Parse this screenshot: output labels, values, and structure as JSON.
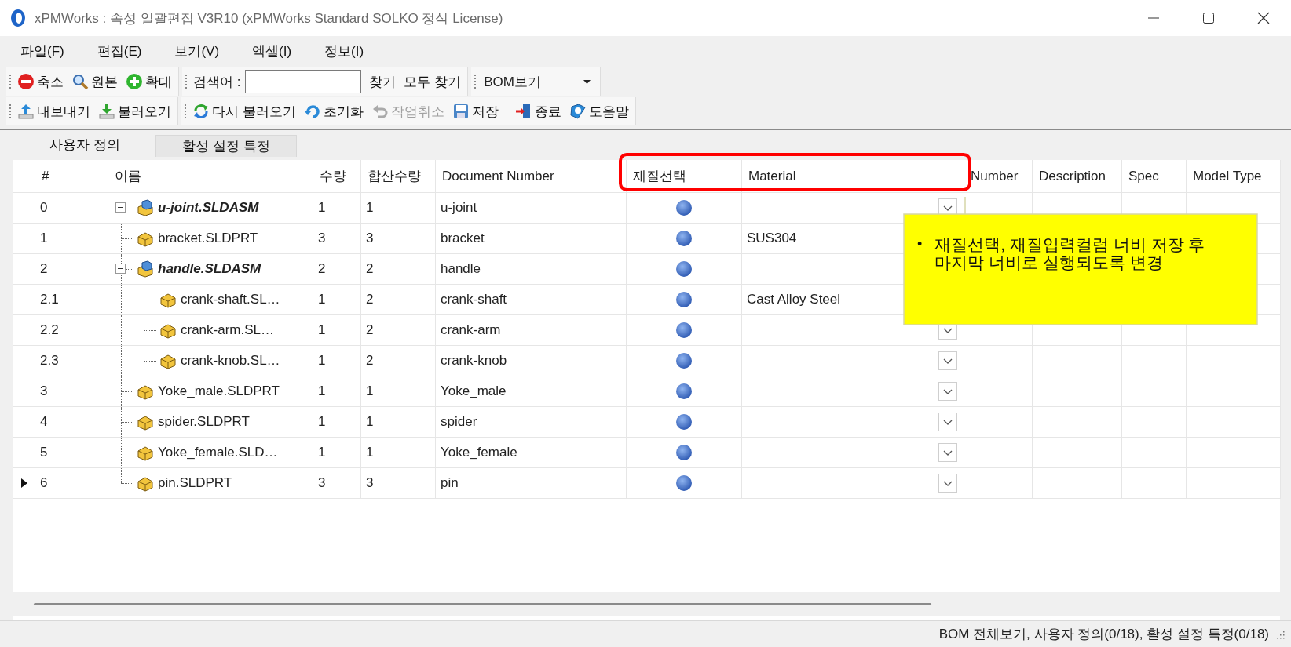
{
  "window": {
    "title": "xPMWorks : 속성 일괄편집 V3R10 (xPMWorks Standard SOLKO 정식 License)"
  },
  "menu": [
    "파일(F)",
    "편집(E)",
    "보기(V)",
    "엑셀(I)",
    "정보(I)"
  ],
  "toolbar": {
    "zoom": [
      {
        "kind": "zoom-out",
        "label": "축소",
        "disabled": false
      },
      {
        "kind": "original",
        "label": "원본",
        "disabled": false
      },
      {
        "kind": "zoom-in",
        "label": "확대",
        "disabled": false
      }
    ],
    "search": {
      "label": "검색어 :",
      "buttons": [
        "찾기",
        "모두 찾기"
      ]
    },
    "view_select": {
      "value": "BOM보기"
    },
    "file": [
      {
        "kind": "export",
        "label": "내보내기",
        "disabled": false
      },
      {
        "kind": "import",
        "label": "불러오기",
        "disabled": false
      }
    ],
    "actions": [
      {
        "kind": "reload",
        "label": "다시 불러오기",
        "disabled": false
      },
      {
        "kind": "reset",
        "label": "초기화",
        "disabled": false
      },
      {
        "kind": "undo",
        "label": "작업취소",
        "disabled": true
      },
      {
        "kind": "save",
        "label": "저장",
        "disabled": false
      }
    ],
    "exit": [
      {
        "kind": "exit",
        "label": "종료",
        "disabled": false
      },
      {
        "kind": "help",
        "label": "도움말",
        "disabled": false
      }
    ]
  },
  "tabs": [
    {
      "label": "사용자 정의",
      "selected": true
    },
    {
      "label": "활성 설정 특정",
      "selected": false
    }
  ],
  "table": {
    "columns": [
      "#",
      "이름",
      "수량",
      "합산수량",
      "Document Number",
      "재질선택",
      "Material",
      "Number",
      "Description",
      "Spec",
      "Model Type"
    ],
    "rows": [
      {
        "no": "0",
        "name": "u-joint.SLDASM",
        "kind": "assembly",
        "expanded": true,
        "qty": "1",
        "total_qty": "1",
        "doc_number": "u-joint",
        "dropdown": true,
        "current": false,
        "children": [
          {
            "no": "1",
            "name": "bracket.SLDPRT",
            "kind": "part",
            "qty": "3",
            "total_qty": "3",
            "doc_number": "bracket",
            "material": "SUS304",
            "dropdown": false,
            "current": false
          },
          {
            "no": "2",
            "name": "handle.SLDASM",
            "kind": "assembly",
            "expanded": true,
            "qty": "2",
            "total_qty": "2",
            "doc_number": "handle",
            "dropdown": false,
            "current": false,
            "children": [
              {
                "no": "2.1",
                "name": "crank-shaft.SL…",
                "kind": "part",
                "qty": "1",
                "total_qty": "2",
                "doc_number": "crank-shaft",
                "material": "Cast Alloy Steel",
                "dropdown": false,
                "current": false
              },
              {
                "no": "2.2",
                "name": "crank-arm.SL…",
                "kind": "part",
                "qty": "1",
                "total_qty": "2",
                "doc_number": "crank-arm",
                "dropdown": true,
                "current": false
              },
              {
                "no": "2.3",
                "name": "crank-knob.SL…",
                "kind": "part",
                "qty": "1",
                "total_qty": "2",
                "doc_number": "crank-knob",
                "dropdown": true,
                "current": false
              }
            ]
          },
          {
            "no": "3",
            "name": "Yoke_male.SLDPRT",
            "kind": "part",
            "qty": "1",
            "total_qty": "1",
            "doc_number": "Yoke_male",
            "dropdown": true,
            "current": false
          },
          {
            "no": "4",
            "name": "spider.SLDPRT",
            "kind": "part",
            "qty": "1",
            "total_qty": "1",
            "doc_number": "spider",
            "dropdown": true,
            "current": false
          },
          {
            "no": "5",
            "name": "Yoke_female.SLD…",
            "kind": "part",
            "qty": "1",
            "total_qty": "1",
            "doc_number": "Yoke_female",
            "dropdown": true,
            "current": false
          },
          {
            "no": "6",
            "name": "pin.SLDPRT",
            "kind": "part",
            "qty": "3",
            "total_qty": "3",
            "doc_number": "pin",
            "dropdown": true,
            "current": true
          }
        ]
      }
    ]
  },
  "annotation": {
    "bullet": "•",
    "text": "재질선택, 재질입력컬럼 너비 저장 후 마지막 너비로 실행되도록 변경"
  },
  "status_bar": {
    "text": "BOM 전체보기, 사용자 정의(0/18), 활성 설정 특정(0/18)"
  }
}
